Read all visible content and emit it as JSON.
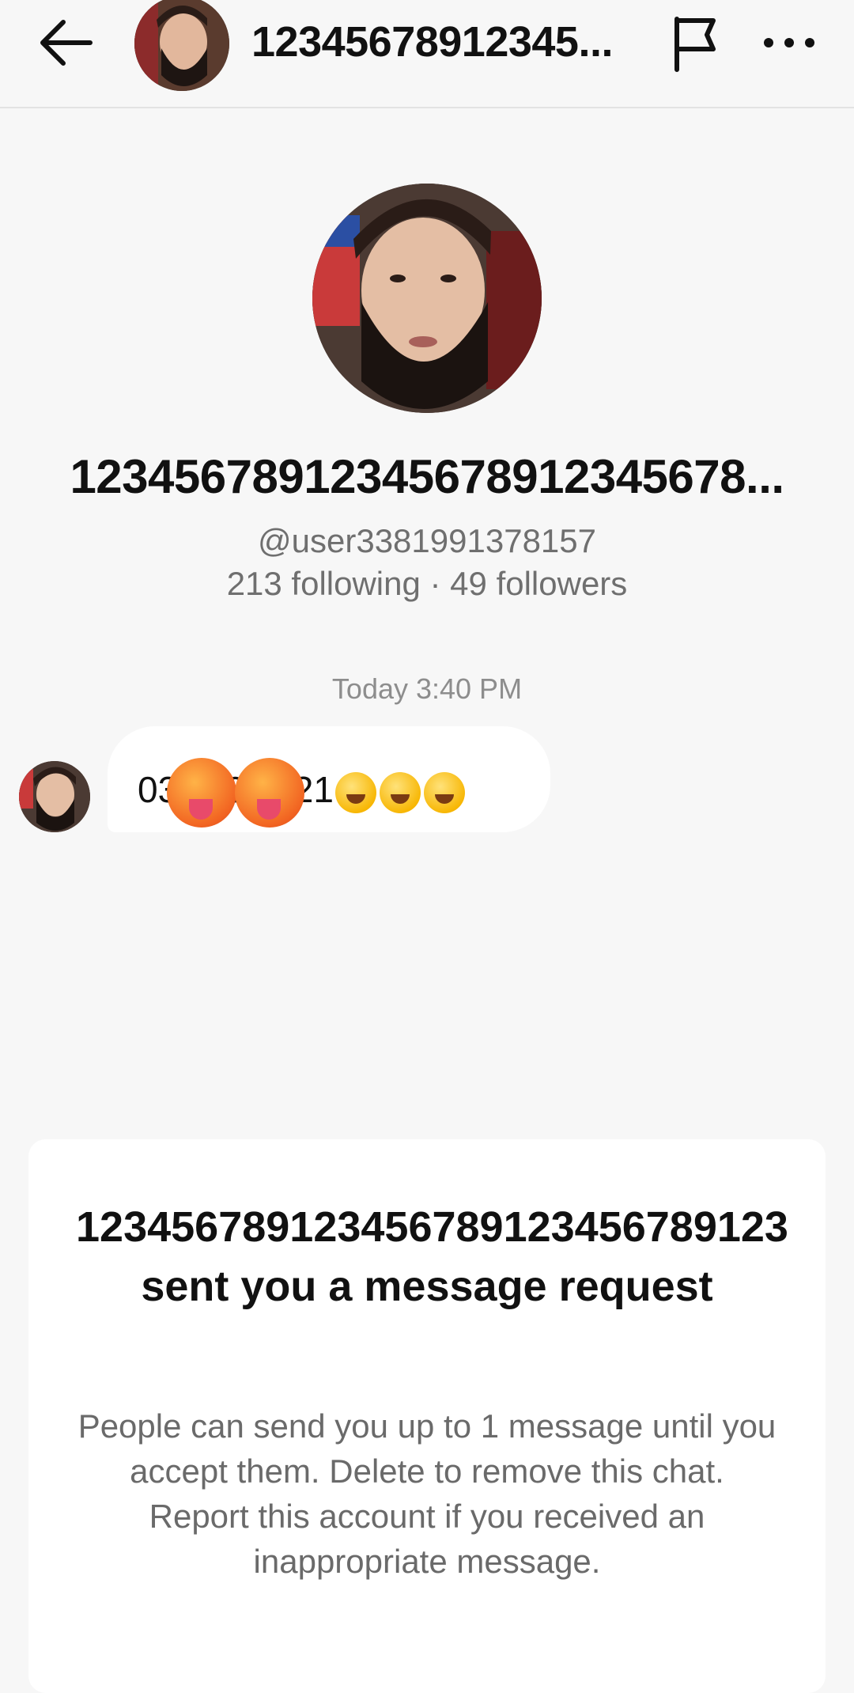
{
  "header": {
    "title": "12345678912345...",
    "back_icon": "arrow-left-icon",
    "flag_icon": "flag-icon",
    "more_icon": "more-horizontal-icon"
  },
  "profile": {
    "display_name": "12345678912345678912345678...",
    "handle": "@user3381991378157",
    "stats": "213 following · 49 followers"
  },
  "conversation": {
    "timestamp": "Today 3:40 PM",
    "message": {
      "text_start": "03",
      "text_mid": "9",
      "text_end": "21",
      "emojis": [
        "hot-face-emoji",
        "hot-face-emoji",
        "zany-face-emoji",
        "rolling-laughing-emoji",
        "joy-emoji"
      ]
    }
  },
  "request_card": {
    "title": "123456789123456789123456789123 sent you a message request",
    "body": "People can send you up to 1 message until you accept them. Delete to remove this chat. Report this account if you received an inappropriate message."
  },
  "colors": {
    "background": "#f7f7f7",
    "card": "#ffffff",
    "secondary_text": "#6f6f6f"
  }
}
